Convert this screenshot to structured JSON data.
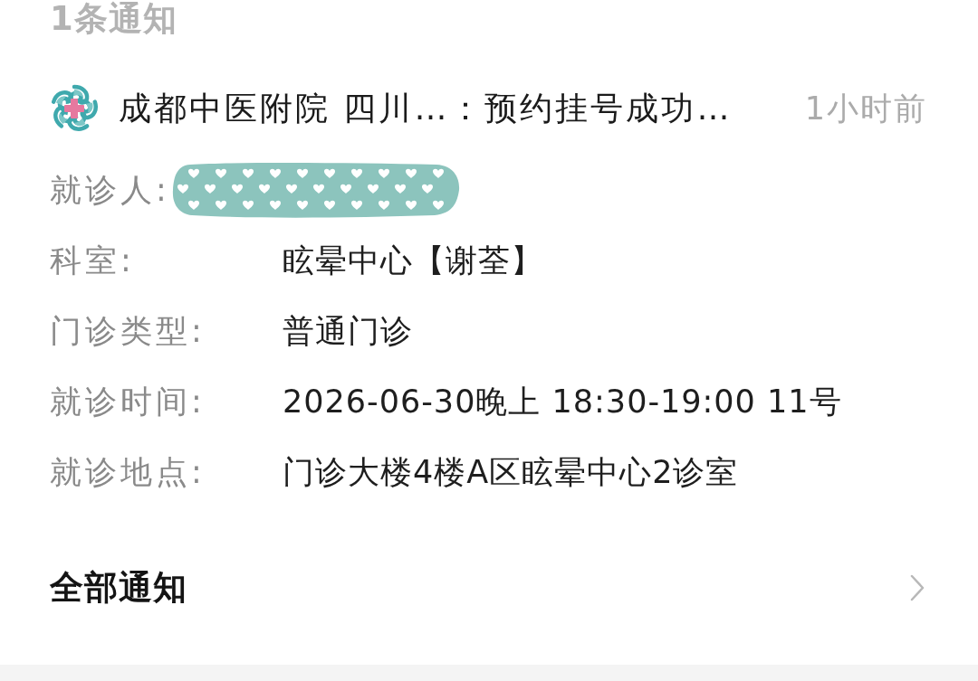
{
  "header": {
    "count_label": "1条通知"
  },
  "notification": {
    "title": "成都中医附院 四川…：预约挂号成功…",
    "time": "1小时前"
  },
  "details": [
    {
      "kind": "redacted",
      "label": "就诊人:"
    },
    {
      "kind": "text",
      "label": "科室:",
      "value": "眩晕中心【谢荃】"
    },
    {
      "kind": "text",
      "label": "门诊类型:",
      "value": "普通门诊"
    },
    {
      "kind": "text",
      "label": "就诊时间:",
      "value": "2026-06-30晚上 18:30-19:00 11号"
    },
    {
      "kind": "text",
      "label": "就诊地点:",
      "value": "门诊大楼4楼A区眩晕中心2诊室"
    }
  ],
  "footer": {
    "label": "全部通知"
  }
}
